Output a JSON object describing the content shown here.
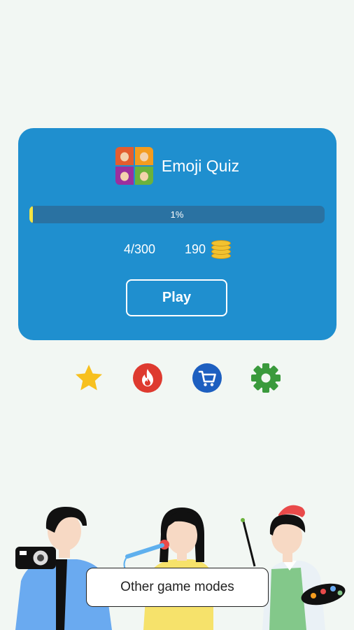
{
  "quiz_card": {
    "title": "Emoji Quiz",
    "progress_text": "1%",
    "progress_fraction": 0.01,
    "level_progress": "4/300",
    "coins": "190",
    "play_label": "Play"
  },
  "icons": [
    {
      "name": "star-icon",
      "color": "#f7c01f"
    },
    {
      "name": "fire-icon",
      "color": "#de3a2f"
    },
    {
      "name": "cart-icon",
      "color": "#1d5fc0"
    },
    {
      "name": "gear-icon",
      "color": "#3a9a3c"
    }
  ],
  "other_modes_label": "Other game modes",
  "colors": {
    "background": "#f2f7f3",
    "card": "#1f8fcf",
    "progress_track": "#2a72a2",
    "progress_fill": "#f4e442"
  }
}
